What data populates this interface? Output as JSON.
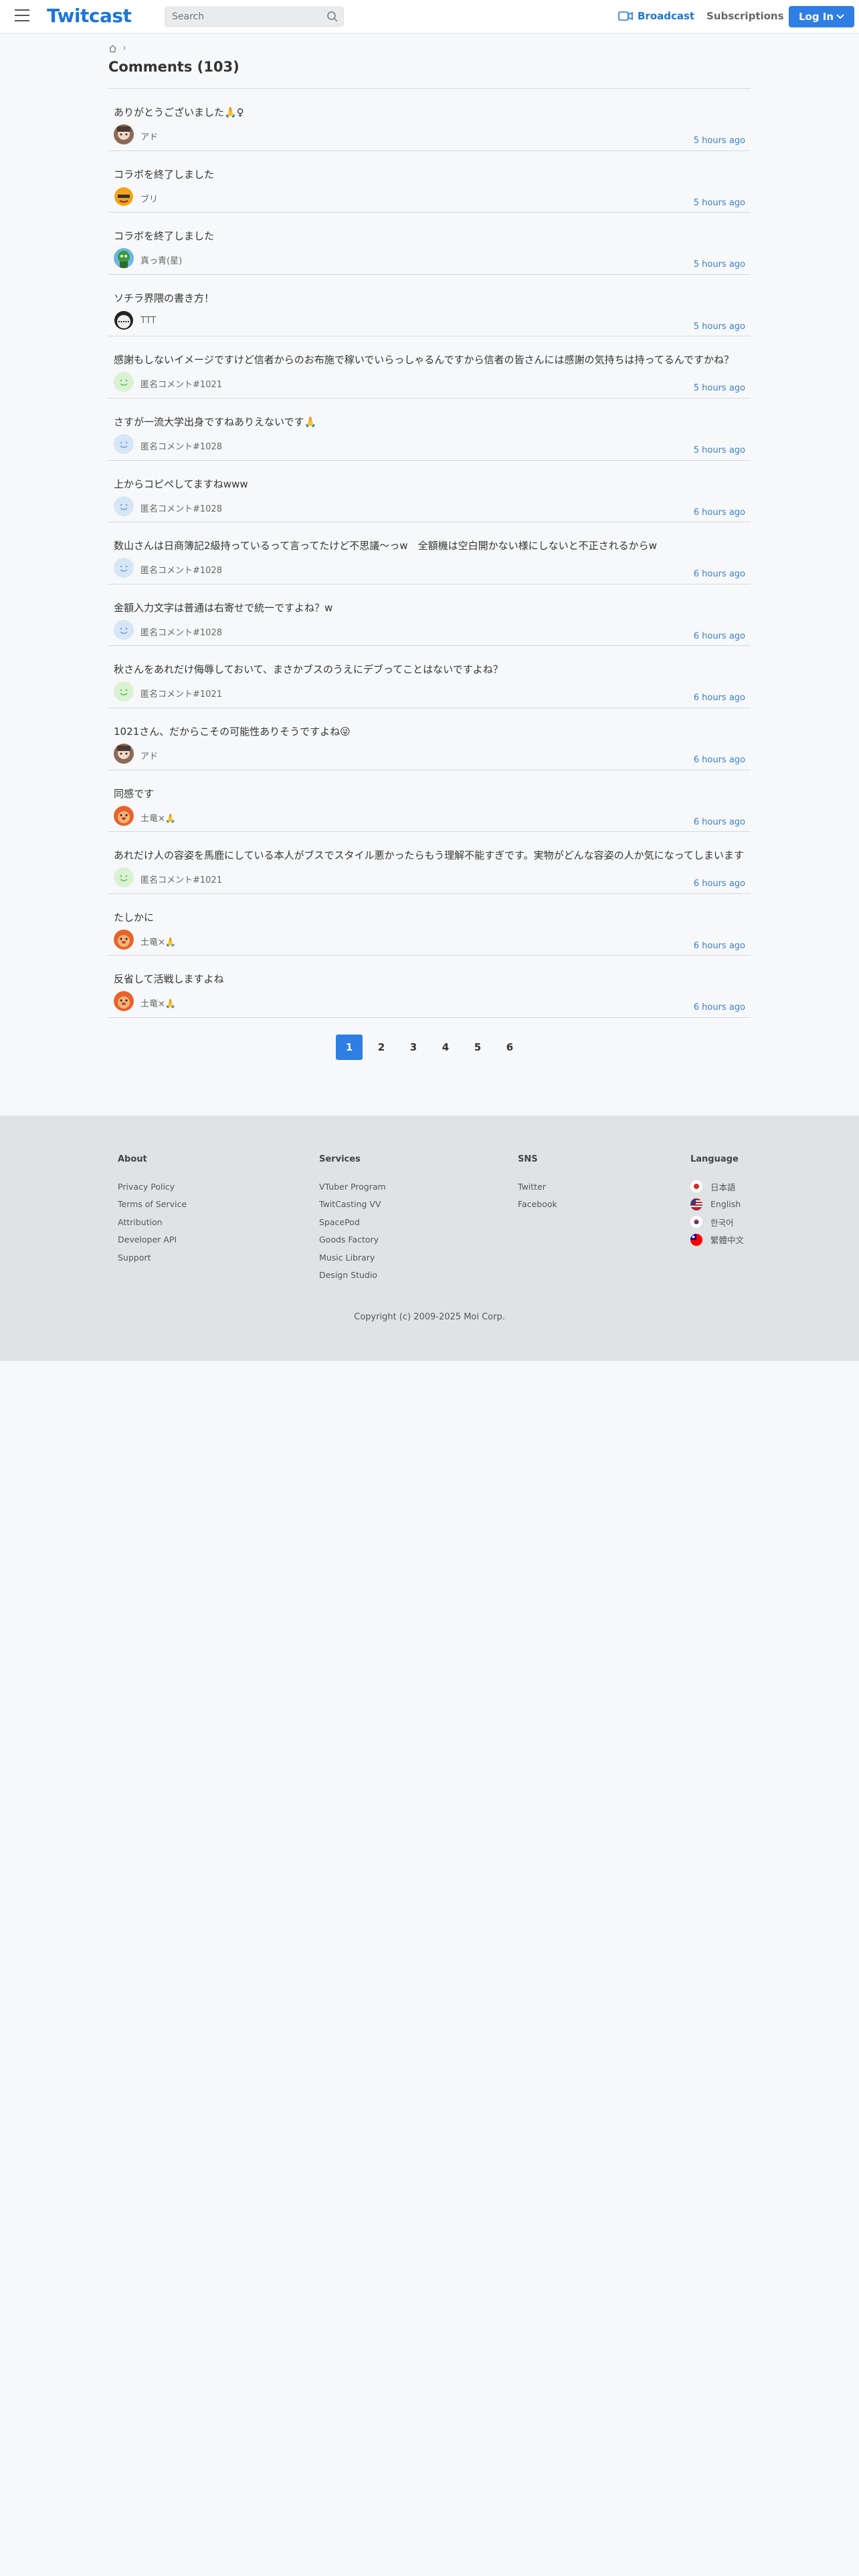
{
  "header": {
    "logo": "Twitcast",
    "search_placeholder": "Search",
    "broadcast_label": "Broadcast",
    "subscriptions_label": "Subscriptions",
    "login_label": "Log In"
  },
  "breadcrumb": {
    "separator": "›"
  },
  "page_title": "Comments (103)",
  "colors": {
    "accent": "#2e7ee3",
    "link": "#3a7fd0",
    "footer_bg": "#e0e3e6"
  },
  "comments": [
    {
      "text": "ありがとうございました🙏♀",
      "name": "アド",
      "time": "5 hours ago",
      "avatar": "avatar-ad"
    },
    {
      "text": "コラボを終了しました",
      "name": "ブリ",
      "time": "5 hours ago",
      "avatar": "avatar-buri"
    },
    {
      "text": "コラボを終了しました",
      "name": "真っ青(星)",
      "time": "5 hours ago",
      "avatar": "avatar-green"
    },
    {
      "text": "ソチラ界隈の書き方！",
      "name": "TTT",
      "time": "5 hours ago",
      "avatar": "avatar-ttt"
    },
    {
      "text": "感謝もしないイメージですけど信者からのお布施で稼いでいらっしゃるんですから信者の皆さんには感謝の気持ちは持ってるんですかね？",
      "name": "匿名コメント#1021",
      "time": "5 hours ago",
      "avatar": "avatar-anon-green"
    },
    {
      "text": "さすが一流大学出身ですねありえないです🙏",
      "name": "匿名コメント#1028",
      "time": "5 hours ago",
      "avatar": "avatar-anon-blue"
    },
    {
      "text": "上からコピペしてますねwww",
      "name": "匿名コメント#1028",
      "time": "6 hours ago",
      "avatar": "avatar-anon-blue"
    },
    {
      "text": "数山さんは日商簿記2級持っているって言ってたけど不思議〜っw　全額機は空白開かない様にしないと不正されるからw",
      "name": "匿名コメント#1028",
      "time": "6 hours ago",
      "avatar": "avatar-anon-blue"
    },
    {
      "text": "金額入力文字は普通は右寄せで統一ですよね？w",
      "name": "匿名コメント#1028",
      "time": "6 hours ago",
      "avatar": "avatar-anon-blue"
    },
    {
      "text": "秋さんをあれだけ侮辱しておいて、まさかブスのうえにデブってことはないですよね？",
      "name": "匿名コメント#1021",
      "time": "6 hours ago",
      "avatar": "avatar-anon-green"
    },
    {
      "text": "1021さん、だからこその可能性ありそうですよね😜",
      "name": "アド",
      "time": "6 hours ago",
      "avatar": "avatar-ad"
    },
    {
      "text": "同感です",
      "name": "土竜×🙏",
      "time": "6 hours ago",
      "avatar": "avatar-mole"
    },
    {
      "text": "あれだけ人の容姿を馬鹿にしている本人がブスでスタイル悪かったらもう理解不能すぎです。実物がどんな容姿の人か気になってしまいます",
      "name": "匿名コメント#1021",
      "time": "6 hours ago",
      "avatar": "avatar-anon-green"
    },
    {
      "text": "たしかに",
      "name": "土竜×🙏",
      "time": "6 hours ago",
      "avatar": "avatar-mole"
    },
    {
      "text": "反省して活戦しますよね",
      "name": "土竜×🙏",
      "time": "6 hours ago",
      "avatar": "avatar-mole"
    }
  ],
  "pagination": {
    "pages": [
      "1",
      "2",
      "3",
      "4",
      "5",
      "6"
    ],
    "current": "1"
  },
  "footer": {
    "about": {
      "title": "About",
      "links": [
        "Privacy Policy",
        "Terms of Service",
        "Attribution",
        "Developer API",
        "Support"
      ]
    },
    "services": {
      "title": "Services",
      "links": [
        "VTuber Program",
        "TwitCasting VV",
        "SpacePod",
        "Goods Factory",
        "Music Library",
        "Design Studio"
      ]
    },
    "sns": {
      "title": "SNS",
      "links": [
        "Twitter",
        "Facebook"
      ]
    },
    "language": {
      "title": "Language",
      "links": [
        "日本語",
        "English",
        "한국어",
        "繁體中文"
      ]
    },
    "copyright": "Copyright (c) 2009-2025 Moi Corp."
  }
}
